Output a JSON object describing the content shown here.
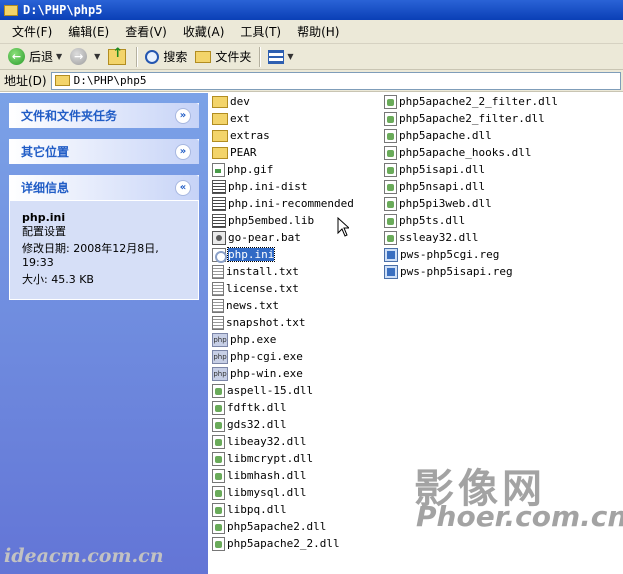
{
  "window": {
    "title": "D:\\PHP\\php5"
  },
  "menu": [
    "文件(F)",
    "编辑(E)",
    "查看(V)",
    "收藏(A)",
    "工具(T)",
    "帮助(H)"
  ],
  "toolbar": {
    "back_label": "后退",
    "search_label": "搜索",
    "folders_label": "文件夹"
  },
  "address": {
    "label": "地址(D)",
    "path": "D:\\PHP\\php5"
  },
  "panels": {
    "tasks": {
      "title": "文件和文件夹任务"
    },
    "other": {
      "title": "其它位置"
    },
    "details": {
      "title": "详细信息",
      "name": "php.ini",
      "type": "配置设置",
      "modified": "修改日期: 2008年12月8日, 19:33",
      "size": "大小: 45.3 KB"
    }
  },
  "files_col1": [
    {
      "name": "dev",
      "icon": "folder"
    },
    {
      "name": "ext",
      "icon": "folder"
    },
    {
      "name": "extras",
      "icon": "folder"
    },
    {
      "name": "PEAR",
      "icon": "folder"
    },
    {
      "name": "php.gif",
      "icon": "gif"
    },
    {
      "name": "php.ini-dist",
      "icon": "cfg"
    },
    {
      "name": "php.ini-recommended",
      "icon": "cfg"
    },
    {
      "name": "php5embed.lib",
      "icon": "lib"
    },
    {
      "name": "go-pear.bat",
      "icon": "bat"
    },
    {
      "name": "php.ini",
      "icon": "ini"
    },
    {
      "name": "install.txt",
      "icon": "txt"
    },
    {
      "name": "license.txt",
      "icon": "txt"
    },
    {
      "name": "news.txt",
      "icon": "txt"
    },
    {
      "name": "snapshot.txt",
      "icon": "txt"
    },
    {
      "name": "php.exe",
      "icon": "exe"
    },
    {
      "name": "php-cgi.exe",
      "icon": "exe"
    },
    {
      "name": "php-win.exe",
      "icon": "exe"
    },
    {
      "name": "aspell-15.dll",
      "icon": "dll"
    },
    {
      "name": "fdftk.dll",
      "icon": "dll"
    },
    {
      "name": "gds32.dll",
      "icon": "dll"
    },
    {
      "name": "libeay32.dll",
      "icon": "dll"
    },
    {
      "name": "libmcrypt.dll",
      "icon": "dll"
    },
    {
      "name": "libmhash.dll",
      "icon": "dll"
    },
    {
      "name": "libmysql.dll",
      "icon": "dll"
    },
    {
      "name": "libpq.dll",
      "icon": "dll"
    },
    {
      "name": "php5apache2.dll",
      "icon": "dll"
    },
    {
      "name": "php5apache2_2.dll",
      "icon": "dll"
    }
  ],
  "files_col2": [
    {
      "name": "php5apache2_2_filter.dll",
      "icon": "dll"
    },
    {
      "name": "php5apache2_filter.dll",
      "icon": "dll"
    },
    {
      "name": "php5apache.dll",
      "icon": "dll"
    },
    {
      "name": "php5apache_hooks.dll",
      "icon": "dll"
    },
    {
      "name": "php5isapi.dll",
      "icon": "dll"
    },
    {
      "name": "php5nsapi.dll",
      "icon": "dll"
    },
    {
      "name": "php5pi3web.dll",
      "icon": "dll"
    },
    {
      "name": "php5ts.dll",
      "icon": "dll"
    },
    {
      "name": "ssleay32.dll",
      "icon": "dll"
    },
    {
      "name": "pws-php5cgi.reg",
      "icon": "reg"
    },
    {
      "name": "pws-php5isapi.reg",
      "icon": "reg"
    }
  ],
  "exe_icon_text": "php",
  "selected_file": "php.ini",
  "watermarks": {
    "w1": "影像网",
    "w2": "Phoer.com.cn",
    "w3": "ideacm.com.cn"
  }
}
